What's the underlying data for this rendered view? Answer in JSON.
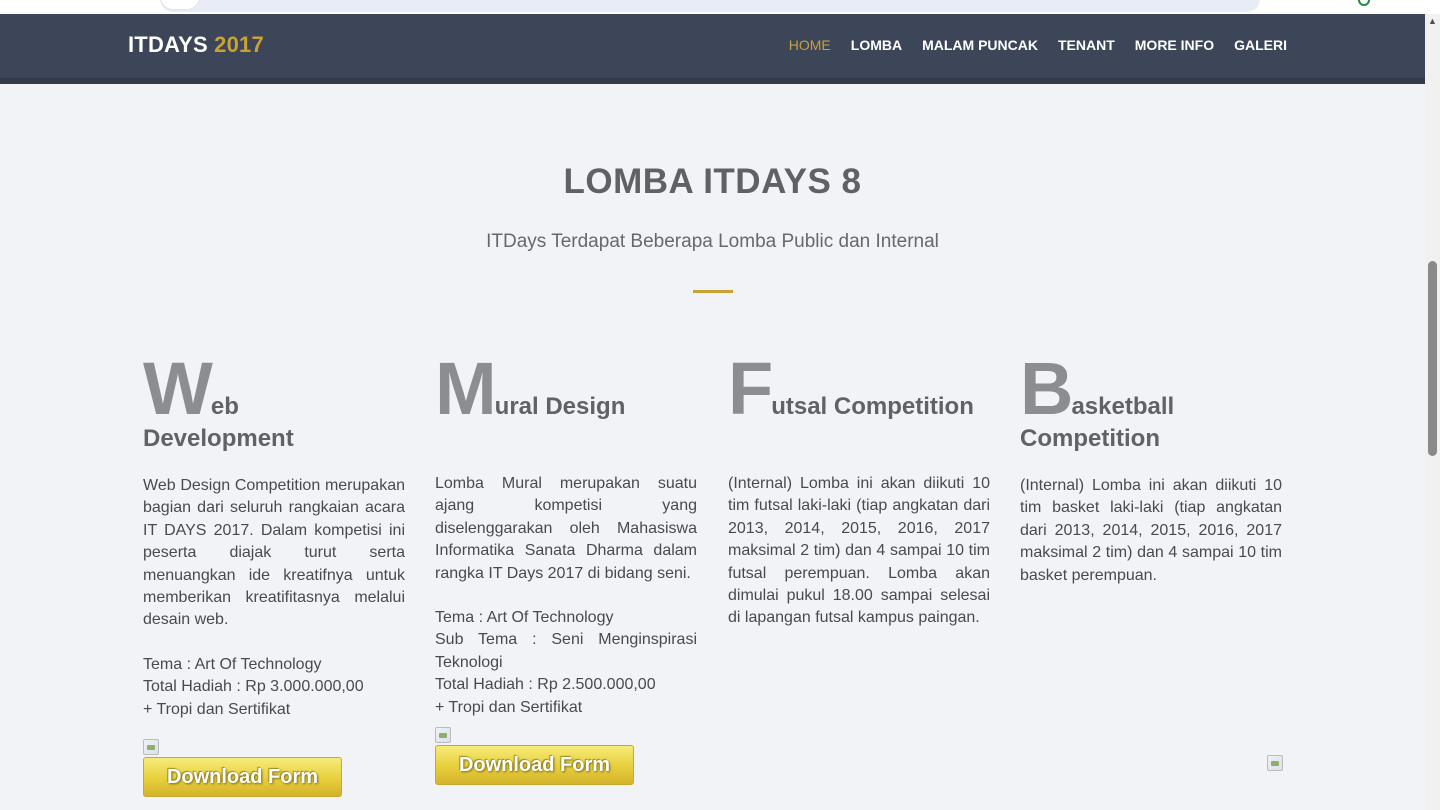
{
  "navbar": {
    "brand": "ITDAYS",
    "brand_year": "2017",
    "menu": [
      {
        "label": "HOME",
        "active": true
      },
      {
        "label": "LOMBA",
        "active": false
      },
      {
        "label": "MALAM PUNCAK",
        "active": false
      },
      {
        "label": "TENANT",
        "active": false
      },
      {
        "label": "MORE INFO",
        "active": false
      },
      {
        "label": "GALERI",
        "active": false
      }
    ]
  },
  "section": {
    "title": "LOMBA ITDAYS 8",
    "subtitle": "ITDays Terdapat Beberapa Lomba Public dan Internal"
  },
  "competitions": [
    {
      "letter": "W",
      "title_rest_1": "eb",
      "title_rest_2": "Development",
      "description": "Web Design Competition merupakan bagian dari seluruh rangkaian acara IT DAYS 2017. Dalam kompetisi ini peserta diajak turut serta menuangkan ide kreatifnya untuk memberikan kreatifitasnya melalui desain web.",
      "tema": "Tema : Art Of Technology",
      "sub_tema": "",
      "hadiah": "Total Hadiah : Rp 3.000.000,00",
      "bonus": "+ Tropi dan Sertifikat",
      "button": "Download Form"
    },
    {
      "letter": "M",
      "title_rest_1": "ural Design",
      "title_rest_2": "",
      "description": "Lomba Mural merupakan suatu ajang kompetisi yang diselenggarakan oleh Mahasiswa Informatika Sanata Dharma dalam rangka IT Days 2017 di bidang seni.",
      "tema": "Tema : Art Of Technology",
      "sub_tema": "Sub Tema : Seni Menginspirasi Teknologi",
      "hadiah": "Total Hadiah : Rp 2.500.000,00",
      "bonus": "+ Tropi dan Sertifikat",
      "button": "Download Form"
    },
    {
      "letter": "F",
      "title_rest_1": "utsal Competition",
      "title_rest_2": "",
      "description": "(Internal) Lomba ini akan diikuti 10 tim futsal laki-laki (tiap angkatan dari 2013, 2014, 2015, 2016, 2017 maksimal 2 tim) dan 4 sampai 10 tim futsal perempuan. Lomba akan dimulai pukul 18.00 sampai selesai di lapangan futsal kampus paingan."
    },
    {
      "letter": "B",
      "title_rest_1": "asketball",
      "title_rest_2": "Competition",
      "description": "(Internal) Lomba ini akan diikuti 10 tim basket laki-laki (tiap angkatan dari 2013, 2014, 2015, 2016, 2017 maksimal 2 tim) dan 4 sampai 10 tim basket perempuan."
    }
  ],
  "colors": {
    "navbar_bg": "#3d4658",
    "accent": "#c9a234",
    "page_bg": "#f2f3f7",
    "button_yellow": "#e7cf3c"
  },
  "icons": {
    "broken_image": "broken-image-icon",
    "scroll_up": "scroll-up-arrow-icon"
  }
}
